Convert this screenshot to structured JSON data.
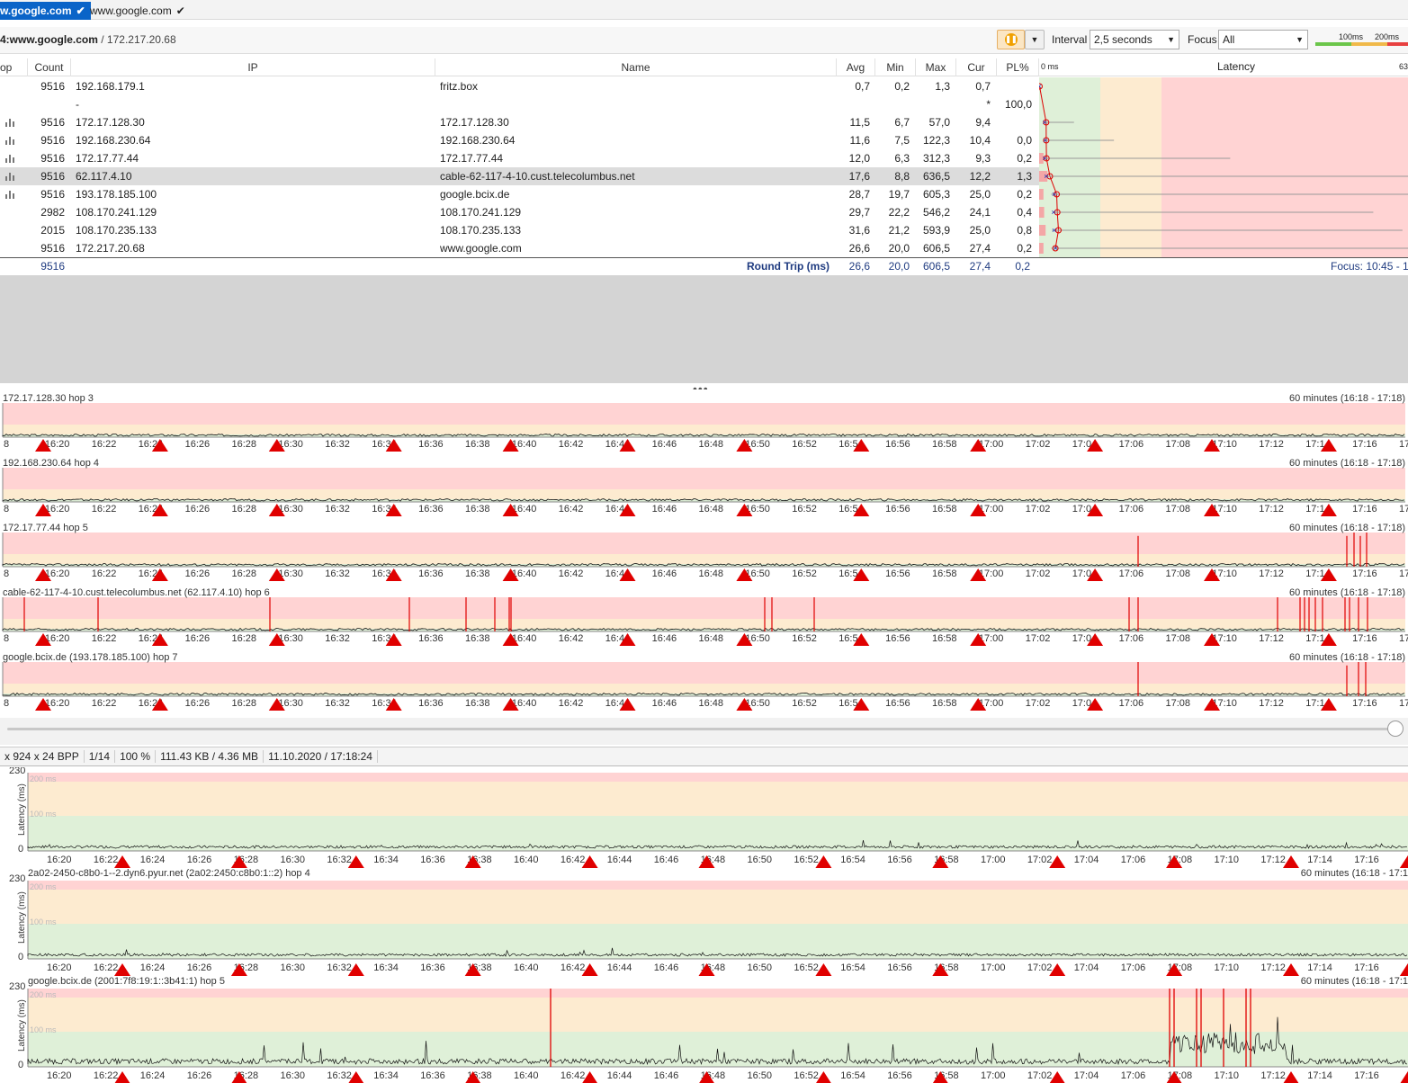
{
  "tabs": [
    {
      "label": "w.google.com",
      "active": true
    },
    {
      "label": "www.google.com",
      "active": false
    }
  ],
  "header": {
    "target_host": "4:www.google.com",
    "target_ip": "/ 172.217.20.68",
    "interval_label": "Interval",
    "interval_value": "2,5 seconds",
    "focus_label": "Focus",
    "focus_value": "All",
    "scale_100": "100ms",
    "scale_200": "200ms"
  },
  "table": {
    "columns": {
      "hop": "op",
      "count": "Count",
      "ip": "IP",
      "name": "Name",
      "avg": "Avg",
      "min": "Min",
      "max": "Max",
      "cur": "Cur",
      "pl": "PL%",
      "latency": "Latency",
      "zero": "0 ms",
      "edge": "63"
    },
    "rows": [
      {
        "count": "9516",
        "ip": "192.168.179.1",
        "name": "fritz.box",
        "avg": "0,7",
        "min": "0,2",
        "max": "1,3",
        "cur": "0,7",
        "pl": "",
        "icon": false,
        "selected": false
      },
      {
        "count": "",
        "ip": "-",
        "name": "",
        "avg": "",
        "min": "",
        "max": "",
        "cur": "*",
        "pl": "100,0",
        "icon": false,
        "selected": false
      },
      {
        "count": "9516",
        "ip": "172.17.128.30",
        "name": "172.17.128.30",
        "avg": "11,5",
        "min": "6,7",
        "max": "57,0",
        "cur": "9,4",
        "pl": "",
        "icon": true,
        "selected": false
      },
      {
        "count": "9516",
        "ip": "192.168.230.64",
        "name": "192.168.230.64",
        "avg": "11,6",
        "min": "7,5",
        "max": "122,3",
        "cur": "10,4",
        "pl": "0,0",
        "icon": true,
        "selected": false
      },
      {
        "count": "9516",
        "ip": "172.17.77.44",
        "name": "172.17.77.44",
        "avg": "12,0",
        "min": "6,3",
        "max": "312,3",
        "cur": "9,3",
        "pl": "0,2",
        "icon": true,
        "selected": false
      },
      {
        "count": "9516",
        "ip": "62.117.4.10",
        "name": "cable-62-117-4-10.cust.telecolumbus.net",
        "avg": "17,6",
        "min": "8,8",
        "max": "636,5",
        "cur": "12,2",
        "pl": "1,3",
        "icon": true,
        "selected": true
      },
      {
        "count": "9516",
        "ip": "193.178.185.100",
        "name": "google.bcix.de",
        "avg": "28,7",
        "min": "19,7",
        "max": "605,3",
        "cur": "25,0",
        "pl": "0,2",
        "icon": true,
        "selected": false
      },
      {
        "count": "2982",
        "ip": "108.170.241.129",
        "name": "108.170.241.129",
        "avg": "29,7",
        "min": "22,2",
        "max": "546,2",
        "cur": "24,1",
        "pl": "0,4",
        "icon": false,
        "selected": false
      },
      {
        "count": "2015",
        "ip": "108.170.235.133",
        "name": "108.170.235.133",
        "avg": "31,6",
        "min": "21,2",
        "max": "593,9",
        "cur": "25,0",
        "pl": "0,8",
        "icon": false,
        "selected": false
      },
      {
        "count": "9516",
        "ip": "172.217.20.68",
        "name": "www.google.com",
        "avg": "26,6",
        "min": "20,0",
        "max": "606,5",
        "cur": "27,4",
        "pl": "0,2",
        "icon": false,
        "selected": false
      }
    ],
    "summary": {
      "count": "9516",
      "label": "Round Trip (ms)",
      "avg": "26,6",
      "min": "20,0",
      "max": "606,5",
      "cur": "27,4",
      "pl": "0,2",
      "focus": "Focus: 10:45 - 17"
    }
  },
  "upper_charts": [
    {
      "title": "172.17.128.30 hop 3",
      "range": "60 minutes (16:18 - 17:18)"
    },
    {
      "title": "192.168.230.64 hop 4",
      "range": "60 minutes (16:18 - 17:18)"
    },
    {
      "title": "172.17.77.44 hop 5",
      "range": "60 minutes (16:18 - 17:18)"
    },
    {
      "title": "cable-62-117-4-10.cust.telecolumbus.net (62.117.4.10) hop 6",
      "range": "60 minutes (16:18 - 17:18)"
    },
    {
      "title": "google.bcix.de (193.178.185.100) hop 7",
      "range": "60 minutes (16:18 - 17:18)"
    }
  ],
  "upper_time_labels": [
    "8",
    "16:20",
    "16:22",
    "16:24",
    "16:26",
    "16:28",
    "16:30",
    "16:32",
    "16:34",
    "16:36",
    "16:38",
    "16:40",
    "16:42",
    "16:44",
    "16:46",
    "16:48",
    "16:50",
    "16:52",
    "16:54",
    "16:56",
    "16:58",
    "17:00",
    "17:02",
    "17:04",
    "17:06",
    "17:08",
    "17:10",
    "17:12",
    "17:14",
    "17:16",
    "17:1"
  ],
  "statusbar": {
    "dims": "x 924 x 24 BPP",
    "page": "1/14",
    "zoom": "100 %",
    "size": "111.43 KB / 4.36 MB",
    "datetime": "11.10.2020 / 17:18:24"
  },
  "lower_charts": [
    {
      "title": "",
      "range": "",
      "ymax": "230",
      "y200": "200 ms",
      "y100": "100 ms",
      "y0": "0",
      "ytitle": "Latency (ms)"
    },
    {
      "title": "2a02-2450-c8b0-1--2.dyn6.pyur.net (2a02:2450:c8b0:1::2) hop 4",
      "range": "60 minutes (16:18 - 17:1",
      "ymax": "230",
      "y200": "200 ms",
      "y100": "100 ms",
      "y0": "0",
      "ytitle": "Latency (ms)"
    },
    {
      "title": "google.bcix.de (2001:7f8:19:1::3b41:1) hop 5",
      "range": "60 minutes (16:18 - 17:1",
      "ymax": "230",
      "y200": "200 ms",
      "y100": "100 ms",
      "y0": "0",
      "ytitle": "Latency (ms)"
    }
  ],
  "lower_time_labels": [
    "16:20",
    "16:22",
    "16:24",
    "16:26",
    "16:28",
    "16:30",
    "16:32",
    "16:34",
    "16:36",
    "16:38",
    "16:40",
    "16:42",
    "16:44",
    "16:46",
    "16:48",
    "16:50",
    "16:52",
    "16:54",
    "16:56",
    "16:58",
    "17:00",
    "17:02",
    "17:04",
    "17:06",
    "17:08",
    "17:10",
    "17:12",
    "17:14",
    "17:16"
  ],
  "colors": {
    "good": "#dff0d8",
    "warn": "#fdebd0",
    "bad": "#ffd3d3",
    "accent": "#0a64c8",
    "marker": "#e00000"
  }
}
